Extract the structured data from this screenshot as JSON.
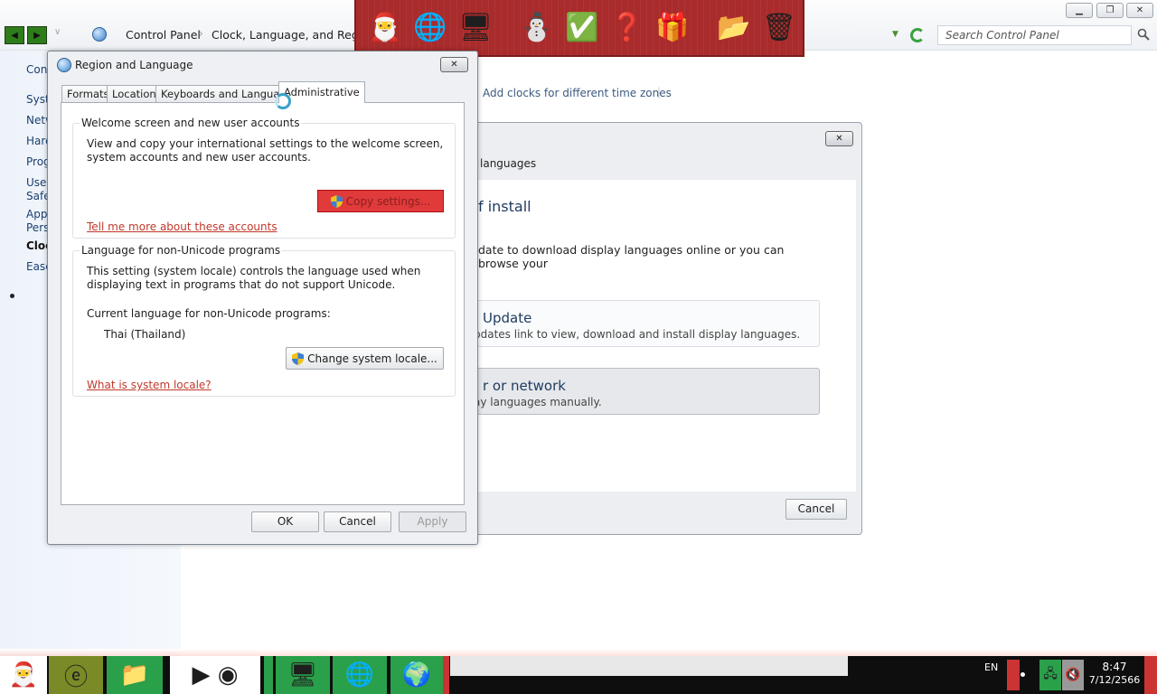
{
  "control_panel": {
    "breadcrumb": [
      "Control Panel",
      "Clock, Language, and Region"
    ],
    "search_placeholder": "Search Control Panel",
    "add_clocks_link": "Add clocks for different time zones",
    "left_nav": [
      "Cont",
      "Syste",
      "Netw",
      "Hard",
      "Prog",
      "User",
      "Safe",
      "App",
      "Pers",
      "Clock",
      "Ease"
    ]
  },
  "region_dialog": {
    "title": "Region and Language",
    "tabs": [
      "Formats",
      "Location",
      "Keyboards and Languages",
      "Administrative"
    ],
    "active_tab": "Administrative",
    "group1": {
      "title": "Welcome screen and new user accounts",
      "desc": "View and copy your international settings to the welcome screen, system accounts and new user accounts.",
      "button": "Copy settings...",
      "link": "Tell me more about these accounts"
    },
    "group2": {
      "title": "Language for non-Unicode programs",
      "desc": "This setting (system locale) controls the language used when displaying text in programs that do not support Unicode.",
      "current_label": "Current language for non-Unicode programs:",
      "current_value": "Thai (Thailand)",
      "button": "Change system locale...",
      "link": "What is system locale?"
    },
    "buttons": {
      "ok": "OK",
      "cancel": "Cancel",
      "apply": "Apply"
    }
  },
  "install_dialog": {
    "title_fragment": "languages",
    "heading_fragment": "f install",
    "desc_fragment": "date to download display languages online or you can browse your",
    "option1_title": "Update",
    "option1_desc": "pdates link to view, download and install display languages.",
    "option2_title": "r or network",
    "option2_desc": "ay languages manually.",
    "cancel": "Cancel"
  },
  "taskbar": {
    "language": "EN",
    "time": "8:47",
    "date": "7/12/2566"
  }
}
